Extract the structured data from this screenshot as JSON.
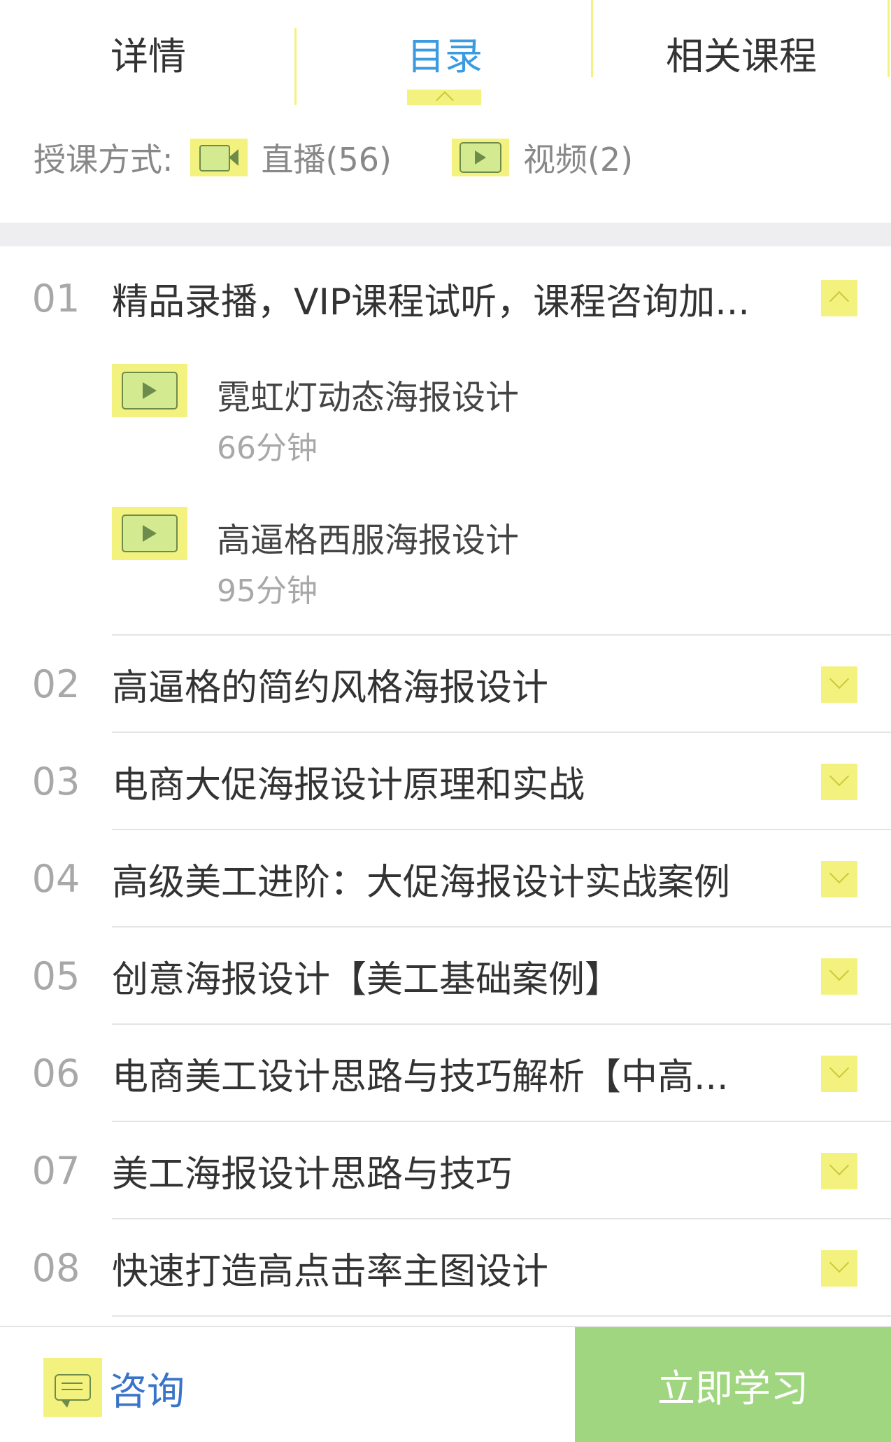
{
  "tabs": [
    {
      "label": "详情"
    },
    {
      "label": "目录"
    },
    {
      "label": "相关课程"
    }
  ],
  "teaching_mode": {
    "label": "授课方式:",
    "live": {
      "icon": "video-camera-icon",
      "text": "直播(56)"
    },
    "video": {
      "icon": "play-icon",
      "text": "视频(2)"
    }
  },
  "chapters": [
    {
      "num": "01",
      "title": "精品录播，VIP课程试听，课程咨询加...",
      "expanded": true,
      "lessons": [
        {
          "icon": "play-icon",
          "title": "霓虹灯动态海报设计",
          "duration": "66分钟"
        },
        {
          "icon": "play-icon",
          "title": "高逼格西服海报设计",
          "duration": "95分钟"
        }
      ]
    },
    {
      "num": "02",
      "title": "高逼格的简约风格海报设计",
      "expanded": false
    },
    {
      "num": "03",
      "title": "电商大促海报设计原理和实战",
      "expanded": false
    },
    {
      "num": "04",
      "title": "高级美工进阶：大促海报设计实战案例",
      "expanded": false
    },
    {
      "num": "05",
      "title": "创意海报设计【美工基础案例】",
      "expanded": false
    },
    {
      "num": "06",
      "title": "电商美工设计思路与技巧解析【中高...",
      "expanded": false
    },
    {
      "num": "07",
      "title": "美工海报设计思路与技巧",
      "expanded": false
    },
    {
      "num": "08",
      "title": "快速打造高点击率主图设计",
      "expanded": false
    }
  ],
  "bottom": {
    "consult_label": "咨询",
    "study_label": "立即学习"
  },
  "colors": {
    "active_tab": "#3a9be0",
    "highlight": "#f4f27e",
    "study_button": "#a0d680"
  }
}
